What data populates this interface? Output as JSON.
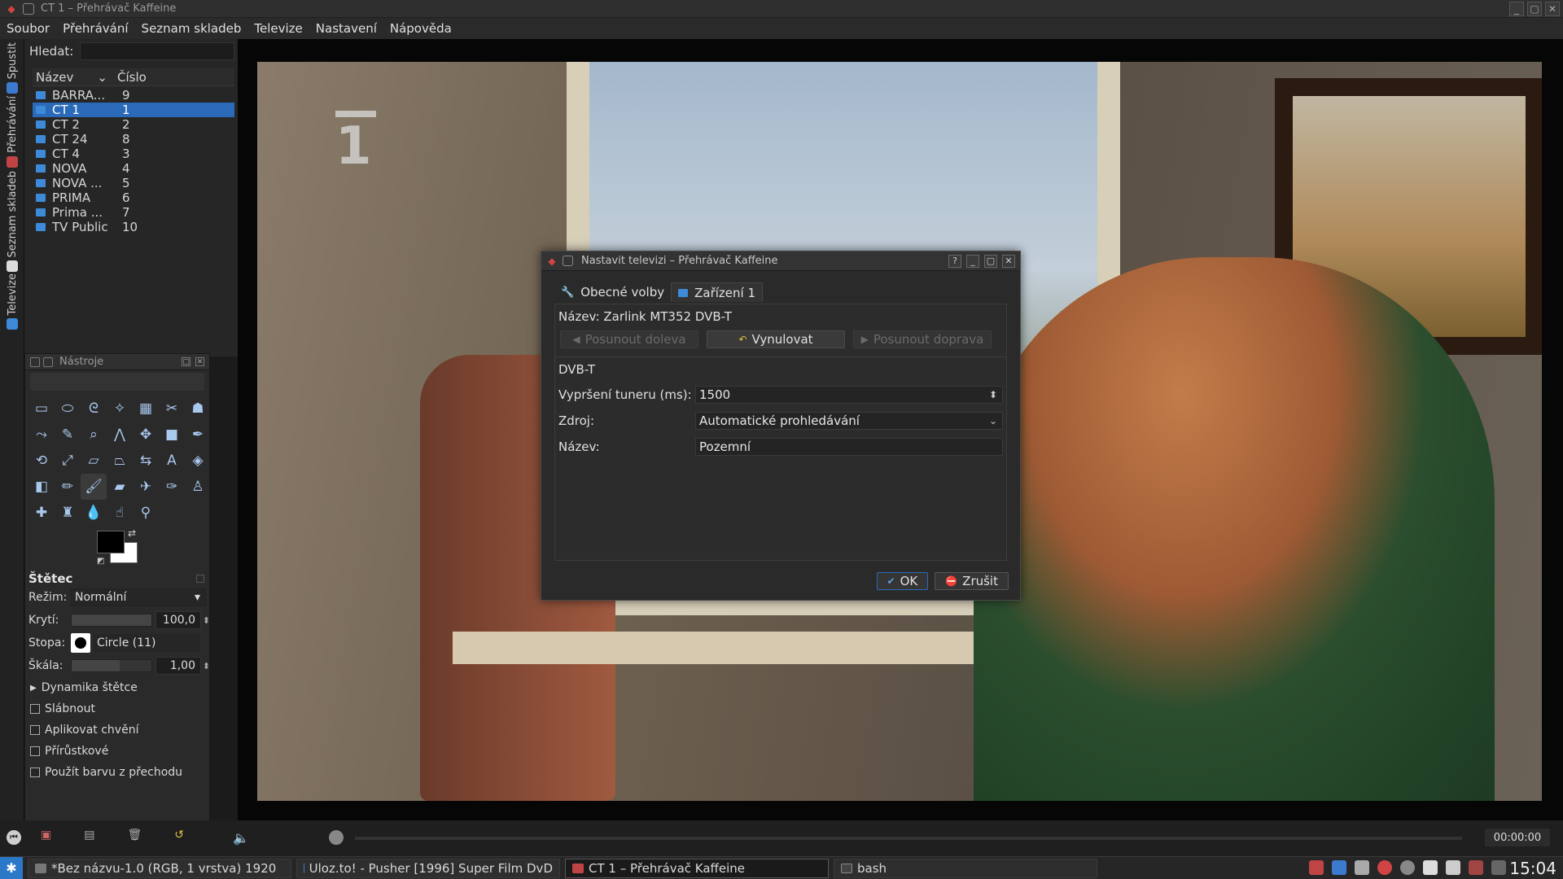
{
  "window": {
    "title": "CT 1 – Přehrávač Kaffeine",
    "controls": [
      "_",
      "▢",
      "✕"
    ]
  },
  "menubar": [
    "Soubor",
    "Přehrávání",
    "Seznam skladeb",
    "Televize",
    "Nastavení",
    "Nápověda"
  ],
  "vertical_tabs": [
    "Spustit",
    "Přehrávání",
    "Seznam skladeb",
    "Televize"
  ],
  "sidebar": {
    "search_label": "Hledat:",
    "search_value": "",
    "col_name": "Název",
    "col_number": "Číslo",
    "channels": [
      {
        "name": "BARRA...",
        "number": "9",
        "selected": false
      },
      {
        "name": "CT 1",
        "number": "1",
        "selected": true
      },
      {
        "name": "CT 2",
        "number": "2",
        "selected": false
      },
      {
        "name": "CT 24",
        "number": "8",
        "selected": false
      },
      {
        "name": "CT 4",
        "number": "3",
        "selected": false
      },
      {
        "name": " NOVA",
        "number": "4",
        "selected": false
      },
      {
        "name": "NOVA ...",
        "number": "5",
        "selected": false
      },
      {
        "name": "PRIMA",
        "number": "6",
        "selected": false
      },
      {
        "name": "Prima ...",
        "number": "7",
        "selected": false
      },
      {
        "name": "TV Public",
        "number": "10",
        "selected": false
      }
    ]
  },
  "tools_panel": {
    "title": "Nástroje",
    "brush_title": "Štětec",
    "mode_label": "Režim:",
    "mode_value": "Normální",
    "opacity_label": "Krytí:",
    "opacity_value": "100,0",
    "stroke_label": "Stopa:",
    "stroke_value": "Circle (11)",
    "scale_label": "Škála:",
    "scale_value": "1,00",
    "dynamics_label": "Dynamika štětce",
    "checkboxes": [
      "Slábnout",
      "Aplikovat chvění",
      "Přírůstkové",
      "Použít barvu z přechodu"
    ]
  },
  "player": {
    "time": "00:00:00"
  },
  "taskbar": {
    "tasks": [
      {
        "label": "*Bez názvu-1.0 (RGB, 1 vrstva) 1920",
        "active": false
      },
      {
        "label": "Uloz.to! - Pusher [1996] Super Film DvD",
        "active": false
      },
      {
        "label": "CT 1 – Přehrávač Kaffeine",
        "active": true
      },
      {
        "label": "bash",
        "active": false
      }
    ],
    "clock": "15:04"
  },
  "video": {
    "channel_logo": "1"
  },
  "dialog": {
    "title": "Nastavit televizi – Přehrávač Kaffeine",
    "title_buttons": [
      "?",
      "_",
      "▢",
      "✕"
    ],
    "tabs": [
      "Obecné volby",
      "Zařízení 1"
    ],
    "device_name": "Název: Zarlink MT352 DVB-T",
    "btn_left": "Posunout doleva",
    "btn_reset": "Vynulovat",
    "btn_right": "Posunout doprava",
    "section": "DVB-T",
    "timeout_label": "Vypršení tuneru (ms):",
    "timeout_value": "1500",
    "source_label": "Zdroj:",
    "source_value": "Automatické prohledávání",
    "name_label": "Název:",
    "name_value": "Pozemní",
    "ok": "OK",
    "cancel": "Zrušit"
  }
}
